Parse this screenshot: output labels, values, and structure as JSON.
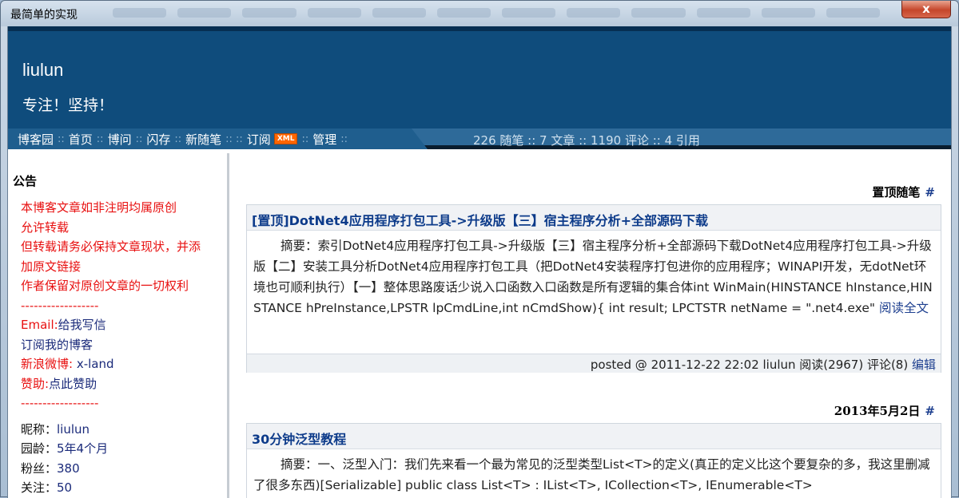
{
  "window": {
    "title": "最简单的实现",
    "close_label": "x"
  },
  "header": {
    "blog_name": "liulun",
    "subtitle": "专注！坚持！"
  },
  "nav": {
    "items": [
      "博客园",
      "首页",
      "博问",
      "闪存",
      "新随笔",
      "订阅",
      "管理"
    ],
    "xml_badge": "XML",
    "stats": "226 随笔 :: 7 文章 :: 1190 评论 :: 4 引用"
  },
  "sidebar": {
    "title": "公告",
    "notice_lines": [
      "本博客文章如非注明均属原创",
      "允许转载",
      "但转载请务必保持文章现状，并添",
      "加原文链接",
      "作者保留对原创文章的一切权利"
    ],
    "divider": "------------------",
    "email_label": "Email:",
    "email_link": "给我写信",
    "subscribe_link": "订阅我的博客",
    "weibo_label": "新浪微博:",
    "weibo_link": "x-land",
    "donate_label": "赞助:",
    "donate_link": "点此赞助",
    "nickname_label": "昵称：",
    "nickname": "liulun",
    "age_label": "园龄：",
    "age": "5年4个月",
    "fans_label": "粉丝：",
    "fans": "380",
    "follow_label": "关注：",
    "follow": "50"
  },
  "main": {
    "sections": [
      {
        "day_title": "置顶随笔",
        "hash": "#",
        "post_title": "[置顶]DotNet4应用程序打包工具->升级版【三】宿主程序分析+全部源码下载",
        "summary": "摘要：索引DotNet4应用程序打包工具->升级版【三】宿主程序分析+全部源码下载DotNet4应用程序打包工具->升级版【二】安装工具分析DotNet4应用程序打包工具（把DotNet4安装程序打包进你的应用程序；WINAPI开发，无dotNet环境也可顺利执行）【一】整体思路废话少说入口函数入口函数是所有逻辑的集合体int WinMain(HINSTANCE hInstance,HINSTANCE hPreInstance,LPSTR lpCmdLine,int nCmdShow){ int result; LPCTSTR netName = \".net4.exe\"",
        "read_more": "阅读全文",
        "footer": "posted @ 2011-12-22 22:02 liulun 阅读(2967) 评论(8)",
        "edit": "编辑"
      },
      {
        "day_title": "2013年5月2日",
        "hash": "#",
        "post_title": "30分钟泛型教程",
        "summary": "摘要：一、泛型入门：我们先来看一个最为常见的泛型类型List<T>的定义(真正的定义比这个要复杂的多，我这里删减了很多东西)[Serializable] public class List<T> : IList<T>, ICollection<T>, IEnumerable<T>"
      }
    ]
  }
}
